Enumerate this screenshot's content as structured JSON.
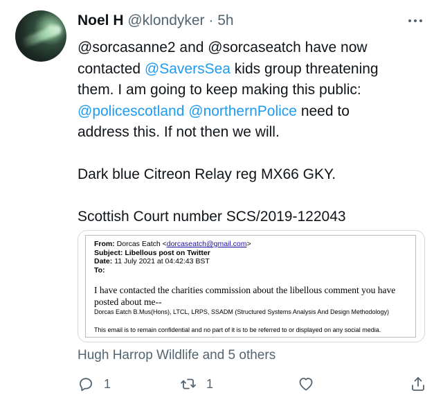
{
  "author": {
    "name": "Noel H",
    "handle": "@klondyker",
    "separator": "·",
    "time": "5h"
  },
  "tweet": {
    "line1": "@sorcasanne2 and @sorcaseatch have now",
    "line2_pre": "contacted ",
    "line2_link": "@SaversSea",
    "line2_post": " kids group threatening",
    "line3": "them. I am going to keep making this public:",
    "line4_link1": "@policescotland",
    "line4_space": " ",
    "line4_link2": "@northernPolice",
    "line4_post": " need to",
    "line5": "address this. If not then we will.",
    "line6": "Dark blue Citreon Relay reg MX66 GKY.",
    "line7": "Scottish Court number SCS/2019-122043"
  },
  "email": {
    "from_label": "From:",
    "from_name": "Dorcas Eatch <",
    "from_email": "dorcaseatch@gmail.com",
    "from_end": ">",
    "subject_label": "Subject:",
    "subject": "Libellous post on Twitter",
    "date_label": "Date:",
    "date": "11 July 2021 at 04:42:43 BST",
    "to_label": "To:",
    "body_line1": "I have contacted the charities commission about the libellous comment you have",
    "body_line2": "posted about me--",
    "signature": "Dorcas Eatch B.Mus(Hons), LTCL, LRPS, SSADM (Structured Systems Analysis And Design Methodology)",
    "note": "This email is to remain confidential and no part of it is to be referred to or displayed on any social media."
  },
  "likers": "Hugh Harrop Wildlife and 5 others",
  "actions": {
    "reply_count": "1",
    "retweet_count": "1"
  },
  "icons": {
    "more": "more-horizontal-icon",
    "reply": "reply-icon",
    "retweet": "retweet-icon",
    "like": "heart-icon",
    "share": "share-icon"
  },
  "colors": {
    "link": "#1d9bf0",
    "secondary_text": "#536471",
    "primary_text": "#0f1419"
  }
}
